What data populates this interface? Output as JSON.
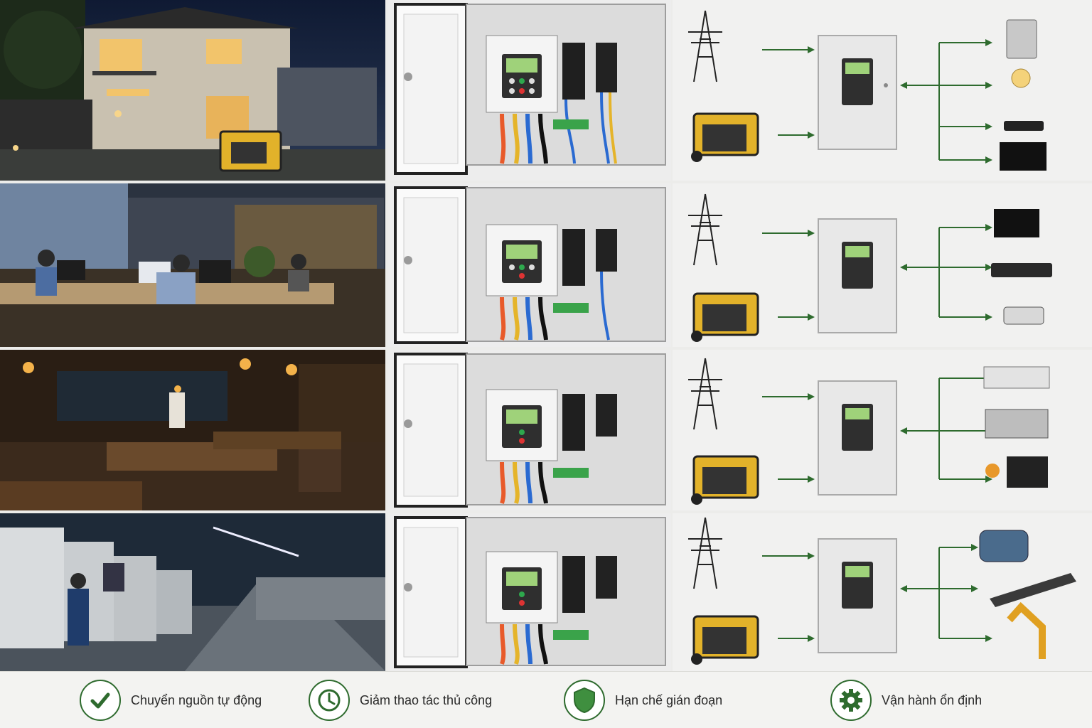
{
  "accent_color": "#2e6b2e",
  "rows": [
    {
      "scene": "residential",
      "loads": [
        "refrigerator-icon",
        "light-bulb-icon",
        "router-icon",
        "tv-icon"
      ]
    },
    {
      "scene": "office",
      "loads": [
        "desktop-computer-icon",
        "network-switch-icon",
        "security-camera-icon"
      ]
    },
    {
      "scene": "restaurant",
      "loads": [
        "ceiling-ac-icon",
        "kitchen-stove-icon",
        "pendant-lamps-pos-icon"
      ]
    },
    {
      "scene": "factory",
      "loads": [
        "electric-motor-icon",
        "conveyor-icon",
        "robot-arm-icon"
      ]
    }
  ],
  "features": [
    {
      "icon": "check-icon",
      "label": "Chuyển nguồn tự động"
    },
    {
      "icon": "clock-icon",
      "label": "Giảm thao tác thủ công"
    },
    {
      "icon": "shield-icon",
      "label": "Hạn chế gián đoạn"
    },
    {
      "icon": "gear-icon",
      "label": "Vận hành ổn định"
    }
  ]
}
